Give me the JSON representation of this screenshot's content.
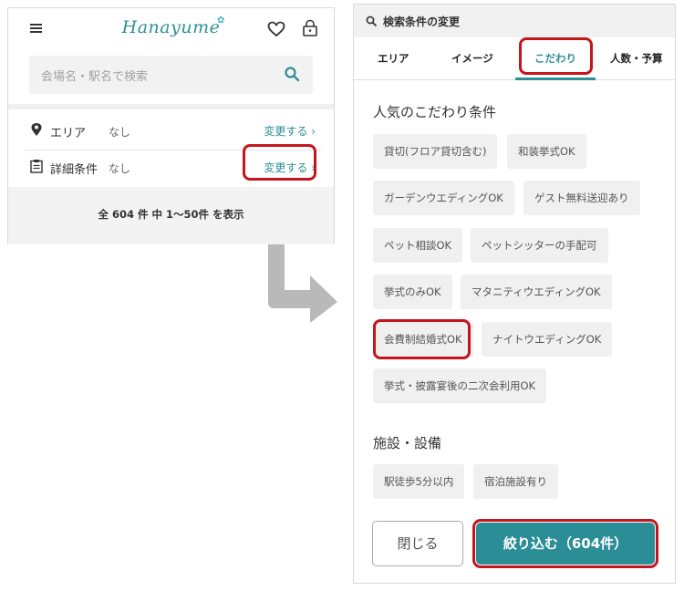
{
  "left": {
    "logo": "Hanayume",
    "search_placeholder": "会場名・駅名で検索",
    "area": {
      "label": "エリア",
      "value": "なし",
      "link": "変更する ›"
    },
    "detail": {
      "label": "詳細条件",
      "value": "なし",
      "link": "変更する ›"
    },
    "result_text": "全 604 件 中 1〜50件 を表示"
  },
  "right": {
    "header_title": "検索条件の変更",
    "tabs": [
      "エリア",
      "イメージ",
      "こだわり",
      "人数・予算"
    ],
    "active_tab": "こだわり",
    "section1_title": "人気のこだわり条件",
    "chips1": [
      "貸切(フロア貸切含む)",
      "和装挙式OK",
      "ガーデンウエディングOK",
      "ゲスト無料送迎あり",
      "ペット相談OK",
      "ペットシッターの手配可",
      "挙式のみOK",
      "マタニティウエディングOK",
      "会費制結婚式OK",
      "ナイトウエディングOK",
      "挙式・披露宴後の二次会利用OK"
    ],
    "section2_title": "施設・設備",
    "chips2": [
      "駅徒歩5分以内",
      "宿泊施設有り"
    ],
    "close_label": "閉じる",
    "submit_label": "絞り込む（604件）"
  },
  "colors": {
    "accent": "#2e8f97",
    "highlight": "#c4151d"
  }
}
